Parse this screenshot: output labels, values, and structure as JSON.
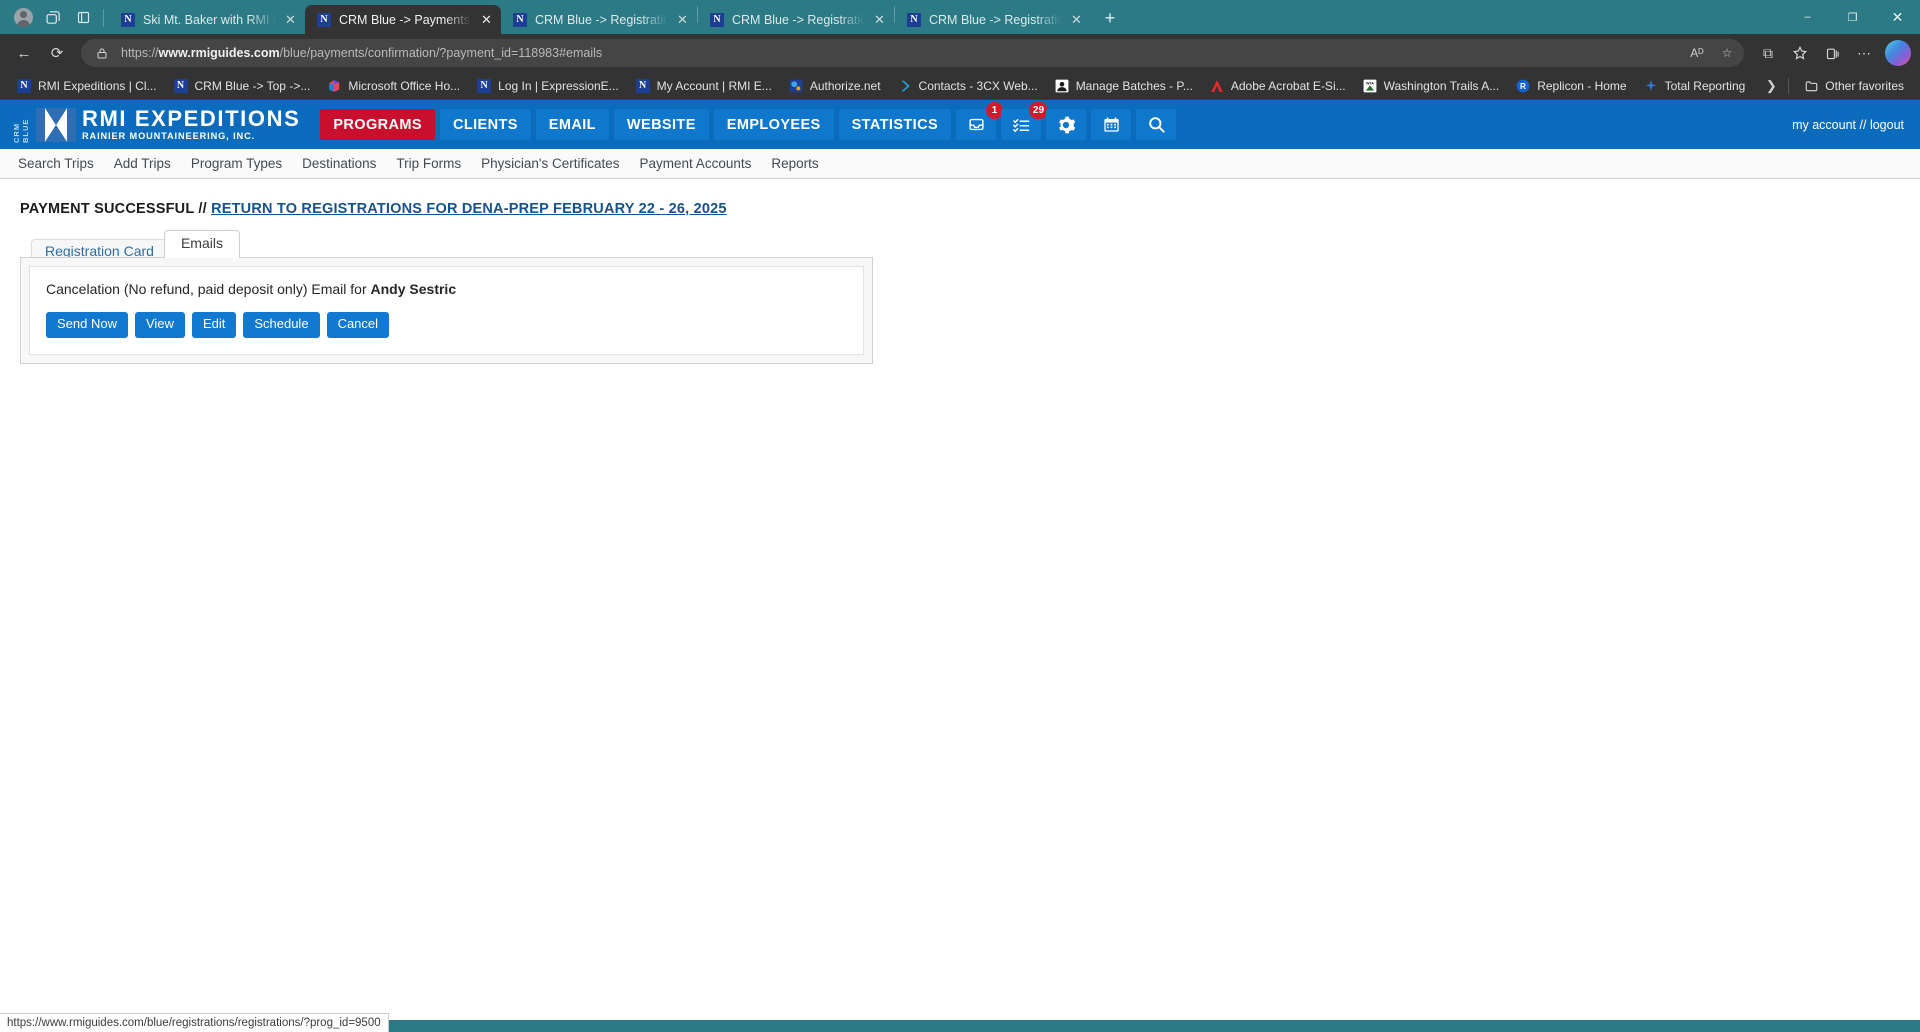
{
  "browser": {
    "toolbar_icons": [
      "profile-avatar",
      "workspaces-icon",
      "tab-list-icon"
    ],
    "tabs": [
      {
        "title": "Ski Mt. Baker with RMI Expeditions",
        "favicon": "rmi-favicon",
        "active": false
      },
      {
        "title": "CRM Blue -> Payments -> Confirmation",
        "favicon": "rmi-favicon",
        "active": true
      },
      {
        "title": "CRM Blue -> Registrations -> Edit",
        "favicon": "rmi-favicon",
        "active": false
      },
      {
        "title": "CRM Blue -> Registrations -> Registrations",
        "favicon": "rmi-favicon",
        "active": false
      },
      {
        "title": "CRM Blue -> Registrations -> Registrations",
        "favicon": "rmi-favicon",
        "active": false
      }
    ],
    "new_tab_label": "+",
    "window_controls": {
      "minimize": "–",
      "maximize": "❐",
      "close": "✕"
    },
    "nav": {
      "back": "←",
      "reload": "⟳",
      "read_aloud": "Aᴰ",
      "favorite": "☆",
      "split_screen": "⧉",
      "collections": "✦",
      "settings_more": "⋯",
      "copilot": "copilot-icon"
    },
    "address": {
      "lock_icon": "lock-icon",
      "url_prefix": "https://",
      "url_domain": "www.rmiguides.com",
      "url_path": "/blue/payments/confirmation/?payment_id=118983#emails"
    },
    "bookmarks": [
      {
        "label": "RMI Expeditions | Cl...",
        "icon": "rmi-favicon"
      },
      {
        "label": "CRM Blue -> Top ->...",
        "icon": "rmi-favicon"
      },
      {
        "label": "Microsoft Office Ho...",
        "icon": "office-icon"
      },
      {
        "label": "Log In | ExpressionE...",
        "icon": "rmi-favicon"
      },
      {
        "label": "My Account | RMI E...",
        "icon": "rmi-favicon"
      },
      {
        "label": "Authorize.net",
        "icon": "authorize-icon"
      },
      {
        "label": "Contacts - 3CX Web...",
        "icon": "3cx-icon"
      },
      {
        "label": "Manage Batches - P...",
        "icon": "batches-icon"
      },
      {
        "label": "Adobe Acrobat E-Si...",
        "icon": "adobe-icon"
      },
      {
        "label": "Washington Trails A...",
        "icon": "wta-icon"
      },
      {
        "label": "Replicon - Home",
        "icon": "replicon-icon"
      },
      {
        "label": "Total Reporting",
        "icon": "total-reporting-icon"
      }
    ],
    "bookmarks_overflow": "❯",
    "other_favorites": {
      "label": "Other favorites",
      "icon": "folder-icon"
    },
    "status_bar_url": "https://www.rmiguides.com/blue/registrations/registrations/?prog_id=9500"
  },
  "app": {
    "logo": {
      "vertical_tag": "CRM BLUE",
      "title": "RMI EXPEDITIONS",
      "subtitle": "RAINIER MOUNTAINEERING, INC."
    },
    "nav_items": [
      {
        "label": "PROGRAMS",
        "active": true
      },
      {
        "label": "CLIENTS",
        "active": false
      },
      {
        "label": "EMAIL",
        "active": false
      },
      {
        "label": "WEBSITE",
        "active": false
      },
      {
        "label": "EMPLOYEES",
        "active": false
      },
      {
        "label": "STATISTICS",
        "active": false
      }
    ],
    "nav_icons": [
      {
        "name": "inbox-icon",
        "badge": "1"
      },
      {
        "name": "tasks-checklist-icon",
        "badge": "29"
      },
      {
        "name": "gear-icon",
        "badge": ""
      },
      {
        "name": "calendar-icon",
        "badge": ""
      },
      {
        "name": "search-icon",
        "badge": ""
      }
    ],
    "account": {
      "my_account": "my account",
      "separator": "//",
      "logout": "logout"
    },
    "submenu": [
      "Search Trips",
      "Add Trips",
      "Program Types",
      "Destinations",
      "Trip Forms",
      "Physician's Certificates",
      "Payment Accounts",
      "Reports"
    ],
    "colors": {
      "header_blue": "#0b6cbd",
      "button_blue": "#0f78cc",
      "programs_red": "#c8102e",
      "badge_red": "#cf1b2b",
      "link_blue": "#14538f"
    }
  },
  "main": {
    "status": {
      "text": "PAYMENT SUCCESSFUL",
      "separator": "//",
      "link": "RETURN TO REGISTRATIONS FOR DENA-PREP FEBRUARY 22 - 26, 2025"
    },
    "tabs": [
      {
        "label": "Registration Card",
        "active": false
      },
      {
        "label": "Emails",
        "active": true
      }
    ],
    "email_card": {
      "description_prefix": "Cancelation (No refund, paid deposit only) Email for ",
      "recipient": "Andy Sestric",
      "buttons": [
        "Send Now",
        "View",
        "Edit",
        "Schedule",
        "Cancel"
      ]
    }
  }
}
